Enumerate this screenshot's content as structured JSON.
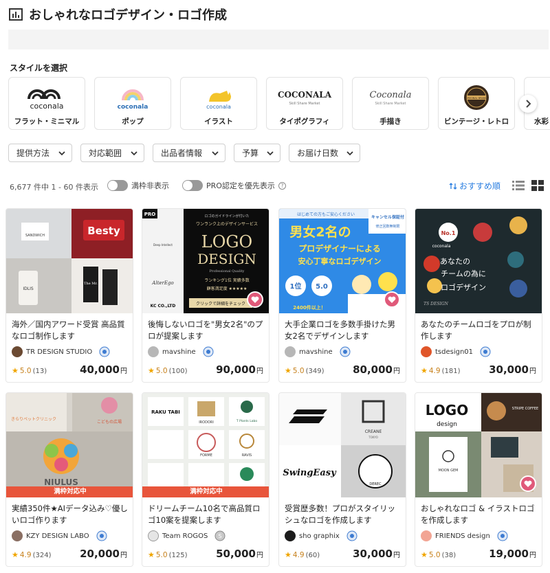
{
  "header": {
    "title": "おしゃれなロゴデザイン・ロゴ作成",
    "icon": "category-icon"
  },
  "styles": {
    "heading": "スタイルを選択",
    "items": [
      {
        "label": "フラット・ミニマル",
        "logo_text": "coconala"
      },
      {
        "label": "ポップ",
        "logo_text": "coconala"
      },
      {
        "label": "イラスト",
        "logo_text": "coconala"
      },
      {
        "label": "タイポグラフィ",
        "logo_text": "COCONALA",
        "logo_sub": "Skill Share Market"
      },
      {
        "label": "手描き",
        "logo_text": "Coconala",
        "logo_sub": "Skill Share Market"
      },
      {
        "label": "ビンテージ・レトロ",
        "logo_text": "ORIGINAL BRAND"
      },
      {
        "label": "水彩"
      }
    ]
  },
  "filters": [
    "提供方法",
    "対応範囲",
    "出品者情報",
    "予算",
    "お届け日数"
  ],
  "results": {
    "count_text": "6,677 件中 1 - 60 件表示",
    "toggle_full": "満枠非表示",
    "toggle_pro": "PRO認定を優先表示",
    "sort_label": "おすすめ順"
  },
  "cards": [
    {
      "title": "海外／国内アワード受賞 高品質なロゴ制作します",
      "seller": "TR DESIGN STUDIO",
      "score": "5.0",
      "reviews": "(13)",
      "price": "40,000",
      "yen": "円",
      "fav": false,
      "soldout": "",
      "thumb_text": [
        "Besty",
        "SANDWICH",
        "The Mr.",
        "IDLIS"
      ]
    },
    {
      "title": "後悔しないロゴを\"男女2名\"のプロが提案します",
      "seller": "mavshine",
      "score": "5.0",
      "reviews": "(100)",
      "price": "90,000",
      "yen": "円",
      "fav": true,
      "soldout": "",
      "thumb_text": [
        "PRO",
        "ロゴのガイドラインが付いた",
        "ワンランク上のデザインサービス",
        "LOGO",
        "DESIGN",
        "Professional Quality",
        "ランキング1位 実績多数",
        "顧客満足度 ★★★★★",
        "クリックで詳細をチェック",
        "Deep Intellect",
        "KC CO.,LTD",
        "AlterEgo"
      ]
    },
    {
      "title": "大手企業ロゴを多数手掛けた男女2名でデザインします",
      "seller": "mavshine",
      "score": "5.0",
      "reviews": "(349)",
      "price": "80,000",
      "yen": "円",
      "fav": true,
      "soldout": "",
      "thumb_text": [
        "はじめての方もご安心ください",
        "キャンセル保証付",
        "修正回数無制限",
        "男女2名の",
        "プロデザイナーによる",
        "安心丁寧なロゴデザイン",
        "1位",
        "5.0",
        "2400件以上！"
      ]
    },
    {
      "title": "あなたのチームロゴをプロが制作します",
      "seller": "tsdesign01",
      "score": "4.9",
      "reviews": "(181)",
      "price": "30,000",
      "yen": "円",
      "fav": false,
      "soldout": "",
      "thumb_text": [
        "coconala",
        "あなたの",
        "チームの為に",
        "ロゴデザイン",
        "TS DESIGN",
        "No.1"
      ]
    },
    {
      "title": "実績350件★AIデータ込み♡優しいロゴ作ります",
      "seller": "KZY DESIGN LABO",
      "score": "4.9",
      "reviews": "(324)",
      "price": "20,000",
      "yen": "円",
      "fav": false,
      "soldout": "満枠対応中",
      "thumb_text": [
        "きらりペットクリニック",
        "こどもの広場",
        "NIULUS"
      ]
    },
    {
      "title": "ドリームチーム10名で高品質ロゴ10案を提案します",
      "seller": "Team ROGOS",
      "score": "5.0",
      "reviews": "(125)",
      "price": "50,000",
      "yen": "円",
      "fav": false,
      "soldout": "満枠対応中",
      "thumb_text": [
        "RAKU TABI",
        "IRODORI",
        "T Plants Labo",
        "FORME",
        "RAVIS"
      ]
    },
    {
      "title": "受賞歴多数！プロがスタイリッシュなロゴを作成します",
      "seller": "sho graphix",
      "score": "4.9",
      "reviews": "(60)",
      "price": "30,000",
      "yen": "円",
      "fav": false,
      "soldout": "",
      "thumb_text": [
        "CREANE",
        "TOKYO",
        "SwingEasy",
        "DEREC"
      ]
    },
    {
      "title": "おしゃれなロゴ & イラストロゴを作成します",
      "seller": "FRIENDS design",
      "score": "5.0",
      "reviews": "(38)",
      "price": "19,000",
      "yen": "円",
      "fav": true,
      "soldout": "",
      "thumb_text": [
        "LOGO",
        "design",
        "STRIPE COFFEE",
        "MOON GEM"
      ]
    }
  ]
}
